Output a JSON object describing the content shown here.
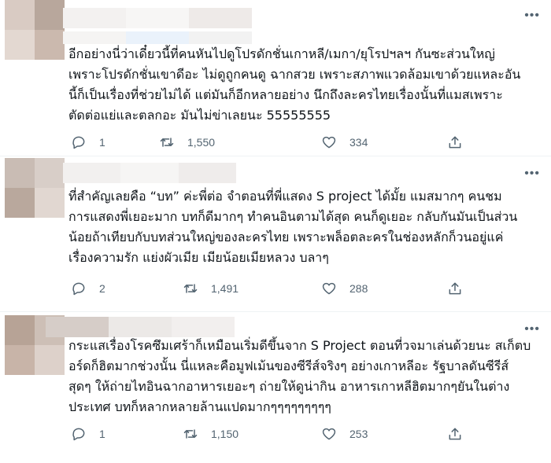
{
  "tweets": [
    {
      "text": "อีกอย่างนี่ว่าเดี๋ยวนี้ที่คนหันไปดูโปรดักชั่นเกาหลี/เมกา/ยุโรปฯลฯ กันซะส่วนใหญ่\nเพราะโปรดักชั่นเขาดีอะ ไม่ดูถูกคนดู ฉากสวย เพราะสภาพแวดล้อมเขาด้วยแหละอัน\nนี้ก็เป็นเรื่องที่ช่วยไม่ได้ แต่มันก็อีกหลายอย่าง นึกถึงละครไทยเรื่องนั้นที่แมสเพราะ\nตัดต่อแย่และตลกอะ มันไม่ข่าเลยนะ 55555555",
      "replies": "1",
      "retweets": "1,550",
      "likes": "334"
    },
    {
      "text": "ที่สำคัญเลยคือ “บท” ค่ะพี่ต่อ จำตอนที่พี่แสดง S project ได้มั้ย แมสมากๆ คนชม\nการแสดงพี่เยอะมาก บทก็ดีมากๆ ทำคนอินตามได้สุด คนก็ดูเยอะ กลับกันมันเป็นส่วน\nน้อยถ้าเทียบกับบทส่วนใหญ่ของละครไทย เพราะพล็อตละครในช่องหลักก็วนอยู่แค่\nเรื่องความรัก แย่งผัวเมีย เมียน้อยเมียหลวง บลาๆ",
      "replies": "2",
      "retweets": "1,491",
      "likes": "288"
    },
    {
      "text": "กระแสเรื่องโรคซึมเศร้าก็เหมือนเริ่มดีขึ้นจาก S Project ตอนที่วจมาเล่นด้วยนะ สเก็ตบ\nอร์ดก็ฮิตมากช่วงนั้น นี่แหละคือมูฟเม้นของซีรีส์จริงๆ อย่างเกาหลีอะ รัฐบาลดันซีรีส์\nสุดๆ ให้ถ่ายไทอินฉากอาหารเยอะๆ ถ่ายให้ดูน่ากิน อาหารเกาหลีฮิตมากๆยันในต่าง\nประเทศ บทก็หลากหลายล้านแปดมากๆๆๆๆๆๆๆๆๆ",
      "replies": "1",
      "retweets": "1,150",
      "likes": "253"
    }
  ],
  "icons": {
    "more": "more-horizontal-icon",
    "reply": "reply-bubble-icon",
    "retweet": "retweet-icon",
    "like": "heart-icon",
    "share": "share-upload-icon"
  },
  "colors": {
    "icon_gray": "#536471",
    "text": "#0f1419",
    "separator": "#eff3f4"
  }
}
